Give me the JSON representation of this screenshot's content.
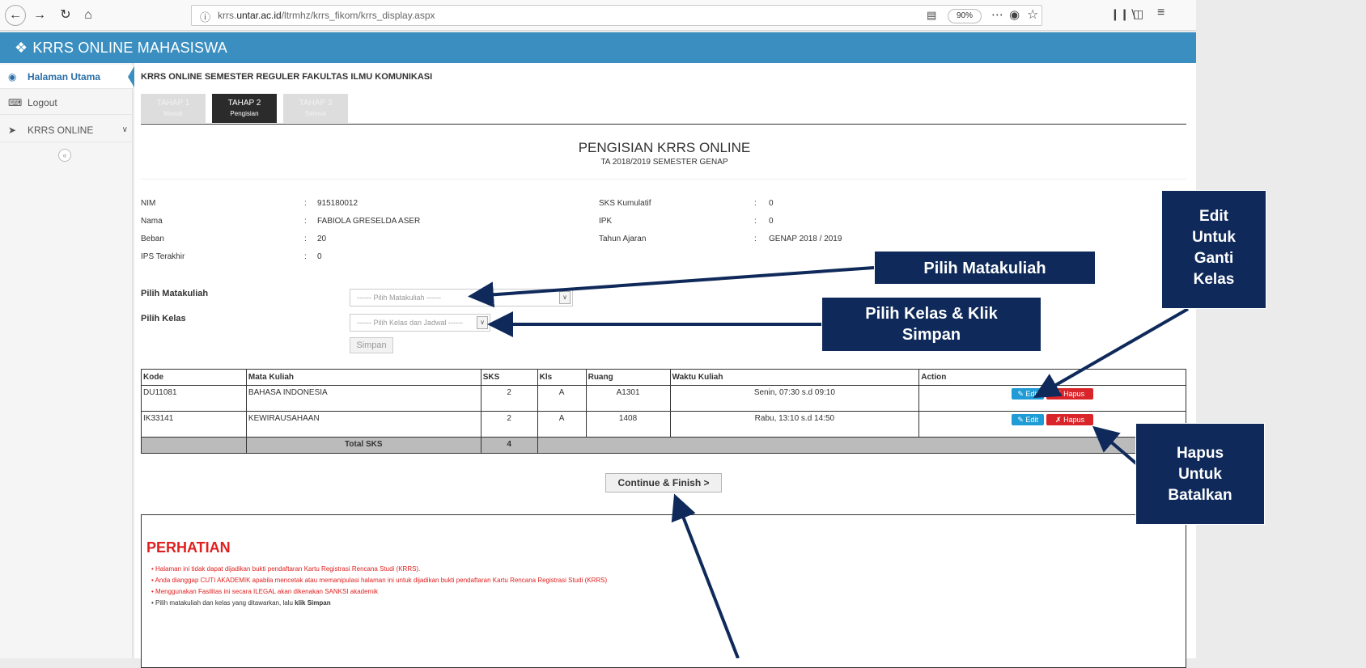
{
  "browser": {
    "url_prefix": "krrs.",
    "url_domain": "untar.ac.id",
    "url_path": "/ltrmhz/krrs_fikom/krrs_display.aspx",
    "zoom": "90%"
  },
  "app": {
    "title": "KRRS ONLINE MAHASISWA"
  },
  "sidebar": {
    "items": [
      {
        "label": "Halaman Utama"
      },
      {
        "label": "Logout"
      },
      {
        "label": "KRRS ONLINE"
      }
    ]
  },
  "main": {
    "section_title": "KRRS ONLINE SEMESTER REGULER FAKULTAS ILMU KOMUNIKASI",
    "steps": [
      {
        "title": "TAHAP 1",
        "sub": "Masuk"
      },
      {
        "title": "TAHAP 2",
        "sub": "Pengisian"
      },
      {
        "title": "TAHAP 3",
        "sub": "Selesai"
      }
    ],
    "form_title": "PENGISIAN KRRS ONLINE",
    "form_subtitle": "TA 2018/2019 SEMESTER GENAP"
  },
  "student": {
    "nim_label": "NIM",
    "nim": "915180012",
    "nama_label": "Nama",
    "nama": "FABIOLA GRESELDA ASER",
    "beban_label": "Beban",
    "beban": "20",
    "ips_label": "IPS Terakhir",
    "ips": "0",
    "sks_kum_label": "SKS Kumulatif",
    "sks_kum": "0",
    "ipk_label": "IPK",
    "ipk": "0",
    "tahun_label": "Tahun Ajaran",
    "tahun": "GENAP  2018 / 2019",
    "colon": ":"
  },
  "form": {
    "matakuliah_label": "Pilih Matakuliah",
    "matakuliah_placeholder": "------ Pilih Matakuliah ------",
    "kelas_label": "Pilih Kelas",
    "kelas_placeholder": "------ Pilih Kelas dan Jadwal ------",
    "simpan_label": "Simpan"
  },
  "table": {
    "headers": [
      "Kode",
      "Mata Kuliah",
      "SKS",
      "Kls",
      "Ruang",
      "Waktu Kuliah",
      "Action"
    ],
    "rows": [
      {
        "kode": "DU11081",
        "mata_kuliah": "BAHASA INDONESIA",
        "sks": "2",
        "kls": "A",
        "ruang": "A1301",
        "waktu": "Senin, 07:30 s.d 09:10"
      },
      {
        "kode": "IK33141",
        "mata_kuliah": "KEWIRAUSAHAAN",
        "sks": "2",
        "kls": "A",
        "ruang": "1408",
        "waktu": "Rabu, 13:10 s.d 14:50"
      }
    ],
    "total_label": "Total SKS",
    "total_value": "4",
    "edit_label": "Edit",
    "hapus_label": "Hapus"
  },
  "continue_label": "Continue & Finish >",
  "notice": {
    "title": "PERHATIAN",
    "items": [
      "Halaman ini tidak dapat dijadikan bukti pendaftaran Kartu Registrasi Rencana Studi (KRRS).",
      "Anda dianggap CUTI AKADEMIK apabila mencetak atau memanipulasi halaman ini untuk dijadikan bukti pendaftaran Kartu Rencana Registrasi Studi (KRRS)",
      "Menggunakan Fasilitas ini secara ILEGAL akan dikenakan SANKSI akademik",
      "Pilih matakuliah dan kelas yang ditawarkan, lalu"
    ],
    "last_emphasis": "klik Simpan"
  },
  "callouts": {
    "matakuliah": "Pilih Matakuliah",
    "kelas_line1": "Pilih  Kelas & Klik",
    "kelas_line2": "Simpan",
    "edit_lines": [
      "Edit",
      "Untuk",
      "Ganti",
      "Kelas"
    ],
    "hapus_lines": [
      "Hapus",
      "Untuk",
      "Batalkan"
    ]
  },
  "colors": {
    "header": "#3a8ec0",
    "callout": "#0f2a5a",
    "edit": "#1f9bd6",
    "hapus": "#d9252a",
    "notice": "#e02020"
  }
}
